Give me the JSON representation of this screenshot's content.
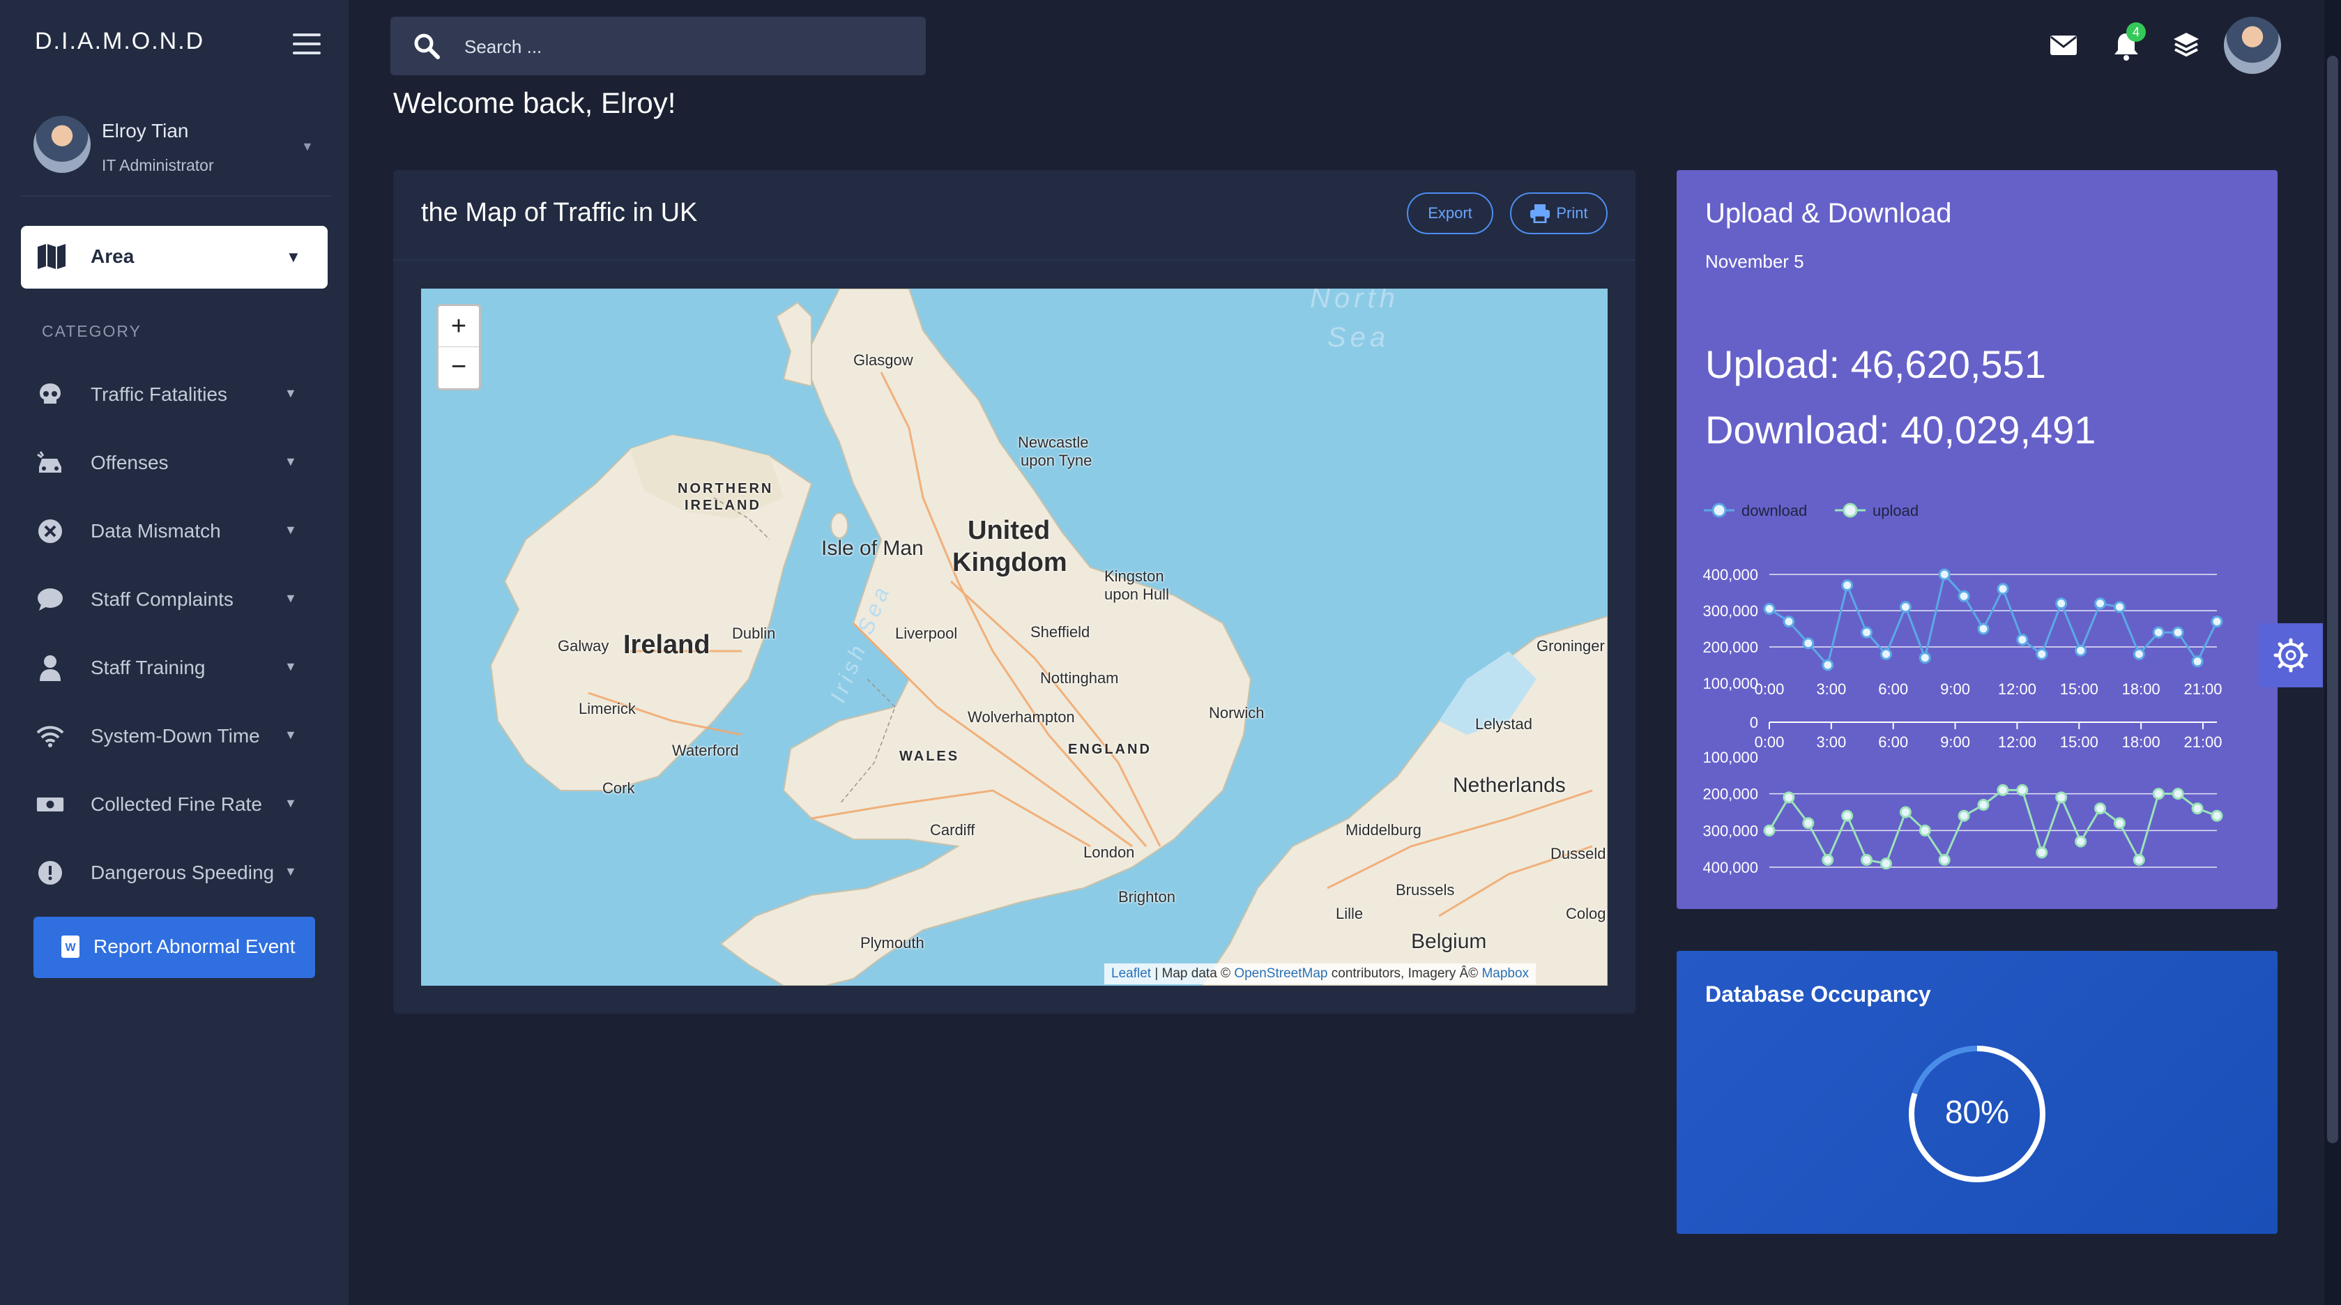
{
  "app": {
    "brand": "D.I.A.M.O.N.D"
  },
  "user": {
    "name": "Elroy Tian",
    "role": "IT Administrator"
  },
  "sidebar": {
    "area_label": "Area",
    "category_heading": "CATEGORY",
    "items": [
      {
        "label": "Traffic Fatalities",
        "icon": "skull-icon"
      },
      {
        "label": "Offenses",
        "icon": "car-crash-icon"
      },
      {
        "label": "Data Mismatch",
        "icon": "x-circle-icon"
      },
      {
        "label": "Staff Complaints",
        "icon": "chat-bubble-icon"
      },
      {
        "label": "Staff Training",
        "icon": "person-icon"
      },
      {
        "label": "System-Down Time",
        "icon": "wifi-icon"
      },
      {
        "label": "Collected Fine Rate",
        "icon": "money-icon"
      },
      {
        "label": "Dangerous Speeding",
        "icon": "exclamation-circle-icon"
      }
    ],
    "report_button": "Report Abnormal Event"
  },
  "topbar": {
    "search_placeholder": "Search ...",
    "notification_count": "4"
  },
  "welcome": "Welcome back, Elroy!",
  "map_card": {
    "title": "the Map of Traffic in UK",
    "export_label": "Export",
    "print_label": "Print",
    "zoom_in": "+",
    "zoom_out": "−",
    "attribution": {
      "leaflet": "Leaflet",
      "sep1": " | Map data © ",
      "osm": "OpenStreetMap",
      "sep2": " contributors, Imagery Â© ",
      "mapbox": "Mapbox"
    },
    "labels": {
      "north_sea_1": "North",
      "north_sea_2": "Sea",
      "glasgow": "Glasgow",
      "newcastle_1": "Newcastle",
      "newcastle_2": "upon Tyne",
      "ni_1": "NORTHERN",
      "ni_2": "IRELAND",
      "isle_of_man": "Isle of Man",
      "uk_1": "United",
      "uk_2": "Kingdom",
      "kingston_1": "Kingston",
      "kingston_2": "upon Hull",
      "irish_sea": "Irish Sea",
      "galway": "Galway",
      "ireland": "Ireland",
      "dublin": "Dublin",
      "liverpool": "Liverpool",
      "sheffield": "Sheffield",
      "groningen": "Groninger",
      "nottingham": "Nottingham",
      "limerick": "Limerick",
      "norwich": "Norwich",
      "wolverhampton": "Wolverhampton",
      "lelystad": "Lelystad",
      "waterford": "Waterford",
      "wales": "WALES",
      "england": "ENGLAND",
      "netherlands": "Netherlands",
      "cork": "Cork",
      "cardiff": "Cardiff",
      "middelburg": "Middelburg",
      "london": "London",
      "dusseld": "Dusseld",
      "brussels": "Brussels",
      "brighton": "Brighton",
      "lille": "Lille",
      "colog": "Colog",
      "plymouth": "Plymouth",
      "belgium": "Belgium"
    }
  },
  "upload_card": {
    "title": "Upload & Download",
    "date": "November 5",
    "upload_text": "Upload: 46,620,551",
    "download_text": "Download: 40,029,491"
  },
  "chart_data": {
    "type": "line",
    "legend": [
      "download",
      "upload"
    ],
    "x_ticks": [
      "0:00",
      "3:00",
      "6:00",
      "9:00",
      "12:00",
      "15:00",
      "18:00",
      "21:00"
    ],
    "upper_y_ticks": [
      "400,000",
      "300,000",
      "200,000",
      "100,000"
    ],
    "lower_y_ticks": [
      "0",
      "100,000",
      "200,000",
      "300,000",
      "400,000"
    ],
    "upper_ylim": [
      100000,
      400000
    ],
    "lower_ylim": [
      100000,
      400000
    ],
    "lower_axis_inverted": true,
    "x": [
      0,
      1,
      2,
      3,
      4,
      5,
      6,
      7,
      8,
      9,
      10,
      11,
      12,
      13,
      14,
      15,
      16,
      17,
      18,
      19,
      20,
      21,
      22,
      23
    ],
    "series": [
      {
        "name": "download",
        "color": "#5ba9e6",
        "panel": "upper",
        "values": [
          305000,
          270000,
          210000,
          150000,
          370000,
          240000,
          180000,
          310000,
          170000,
          400000,
          340000,
          250000,
          360000,
          220000,
          180000,
          320000,
          190000,
          320000,
          310000,
          180000,
          240000,
          240000,
          160000,
          270000
        ]
      },
      {
        "name": "upload",
        "color": "#9be3b9",
        "panel": "lower",
        "values": [
          300000,
          210000,
          280000,
          380000,
          260000,
          380000,
          390000,
          250000,
          300000,
          380000,
          260000,
          230000,
          190000,
          190000,
          360000,
          210000,
          330000,
          240000,
          280000,
          380000,
          200000,
          200000,
          240000,
          260000
        ]
      }
    ]
  },
  "db_card": {
    "title": "Database Occupancy",
    "percent": 80,
    "percent_label": "80%"
  },
  "colors": {
    "background": "#1b2133",
    "sidebar": "#222b41",
    "accent_blue": "#2f6fe0",
    "upload_card": "#6661c9",
    "db_card": "#2559c6",
    "notification_badge": "#35c759"
  }
}
